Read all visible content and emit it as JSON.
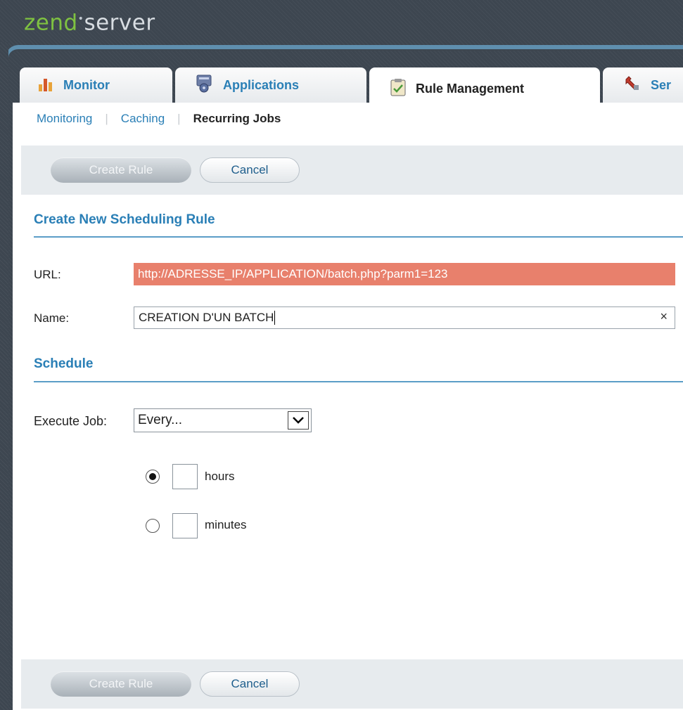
{
  "brand": {
    "name_part1": "zend",
    "name_part2": "server"
  },
  "tabs": [
    {
      "label": "Monitor",
      "icon": "bar-chart-icon"
    },
    {
      "label": "Applications",
      "icon": "applications-icon"
    },
    {
      "label": "Rule Management",
      "icon": "clipboard-icon"
    },
    {
      "label": "Ser",
      "icon": "wrench-icon"
    }
  ],
  "subnav": {
    "items": [
      "Monitoring",
      "Caching",
      "Recurring Jobs"
    ],
    "active": "Recurring Jobs"
  },
  "toolbar": {
    "create_label": "Create Rule",
    "cancel_label": "Cancel"
  },
  "form": {
    "section_title": "Create New Scheduling Rule",
    "url_label": "URL:",
    "url_value": "http://ADRESSE_IP/APPLICATION/batch.php?parm1=123",
    "name_label": "Name:",
    "name_value": "CREATION D'UN BATCH",
    "clear_symbol": "×"
  },
  "schedule": {
    "section_title": "Schedule",
    "execute_label": "Execute Job:",
    "execute_value": "Every...",
    "option_hours": "hours",
    "option_minutes": "minutes",
    "selected": "hours"
  },
  "colors": {
    "accent": "#2a7fb6",
    "url_invalid_bg": "#e8806c",
    "header_bg": "#3d4650"
  }
}
